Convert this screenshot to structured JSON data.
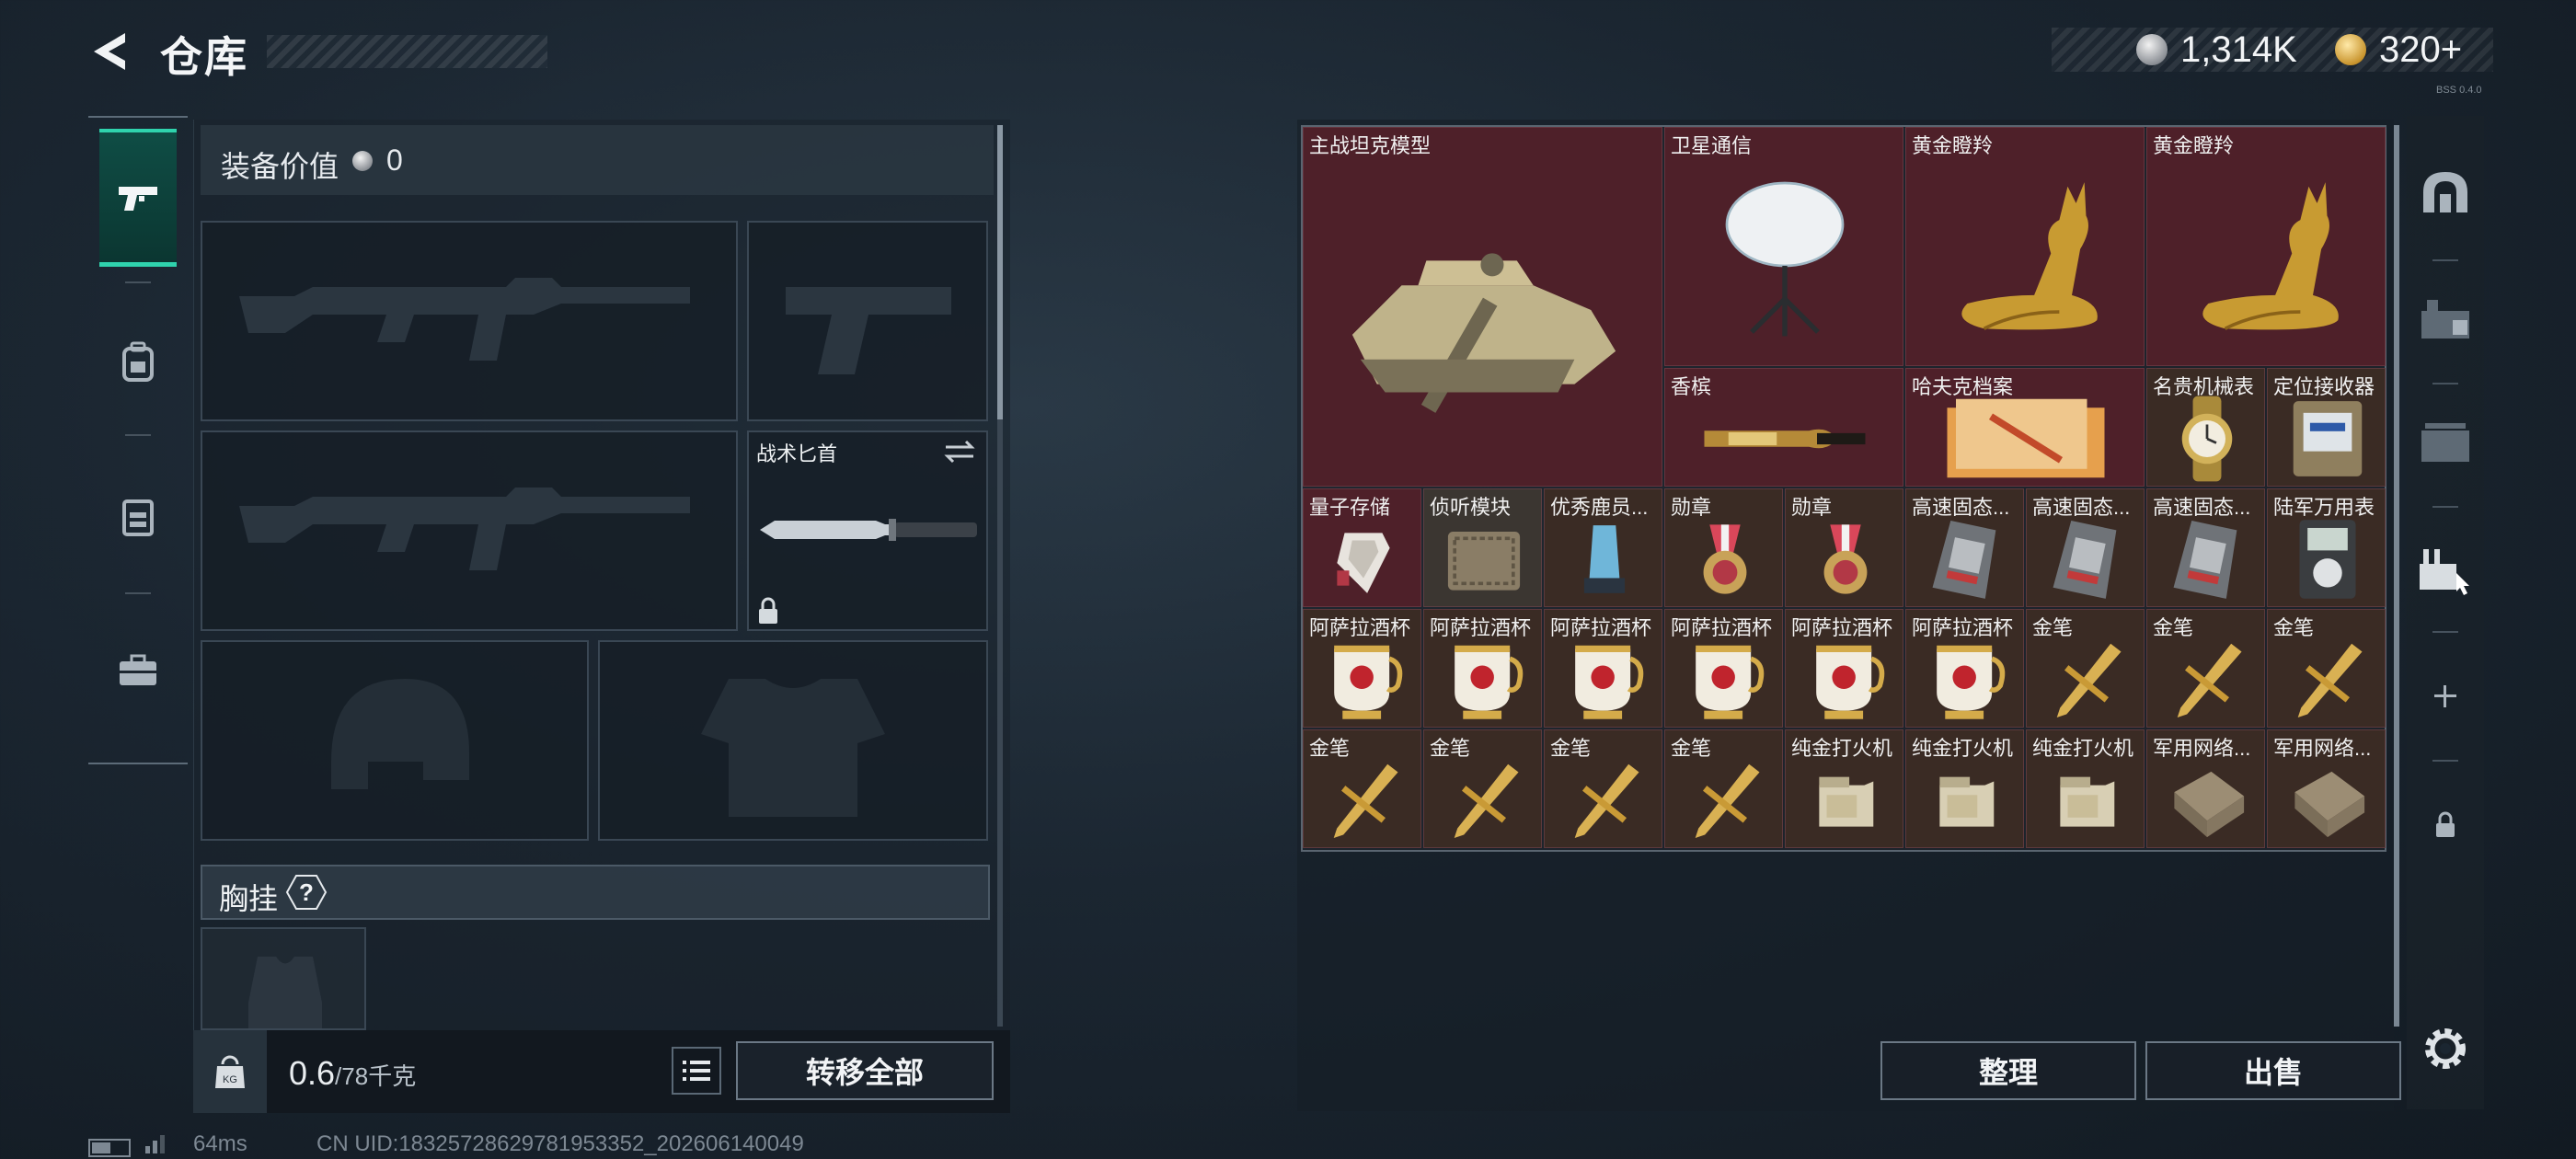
{
  "header": {
    "title": "仓库",
    "currency": [
      {
        "icon": "silver-coin-icon",
        "value": "1,314K"
      },
      {
        "icon": "gold-coin-icon",
        "value": "320+"
      }
    ],
    "version_tag": "BSS 0.4.0"
  },
  "left_tabs": [
    {
      "name": "weapon-tab",
      "icon": "pistol-icon",
      "active": true
    },
    {
      "name": "armor-tab",
      "icon": "backpack-icon",
      "active": false
    },
    {
      "name": "rig-tab",
      "icon": "chest-rig-icon",
      "active": false
    },
    {
      "name": "case-tab",
      "icon": "briefcase-icon",
      "active": false
    }
  ],
  "loadout": {
    "equip_value_label": "装备价值",
    "equip_value": "0",
    "knife_label": "战术匕首",
    "vest_label": "胸挂",
    "help_glyph": "?",
    "weight_current": "0.6",
    "weight_max": "/78千克",
    "transfer_all": "转移全部"
  },
  "stash": {
    "items": [
      {
        "label": "主战坦克模型",
        "bg": "red",
        "art": "tank-model-icon"
      },
      {
        "label": "卫星通信",
        "bg": "red",
        "art": "satellite-dish-icon"
      },
      {
        "label": "黄金瞪羚",
        "bg": "red",
        "art": "gold-gazelle-icon"
      },
      {
        "label": "黄金瞪羚",
        "bg": "red",
        "art": "gold-gazelle-icon"
      },
      {
        "label": "香槟",
        "bg": "red",
        "art": "champagne-icon"
      },
      {
        "label": "哈夫克档案",
        "bg": "red",
        "art": "folder-icon"
      },
      {
        "label": "名贵机械表",
        "bg": "brown",
        "art": "watch-icon"
      },
      {
        "label": "定位接收器",
        "bg": "brown",
        "art": "receiver-icon"
      },
      {
        "label": "量子存储",
        "bg": "red",
        "art": "quantum-storage-icon"
      },
      {
        "label": "侦听模块",
        "bg": "gray",
        "art": "module-icon"
      },
      {
        "label": "优秀鹿员...",
        "bg": "brown",
        "art": "trophy-icon"
      },
      {
        "label": "勋章",
        "bg": "brown",
        "art": "medal-icon"
      },
      {
        "label": "勋章",
        "bg": "brown",
        "art": "medal-icon"
      },
      {
        "label": "高速固态...",
        "bg": "brown",
        "art": "ssd-icon"
      },
      {
        "label": "高速固态...",
        "bg": "brown",
        "art": "ssd-icon"
      },
      {
        "label": "高速固态...",
        "bg": "brown",
        "art": "ssd-icon"
      },
      {
        "label": "陆军万用表",
        "bg": "brown",
        "art": "multimeter-icon"
      },
      {
        "label": "阿萨拉酒杯",
        "bg": "brown",
        "art": "goblet-icon"
      },
      {
        "label": "阿萨拉酒杯",
        "bg": "brown",
        "art": "goblet-icon"
      },
      {
        "label": "阿萨拉酒杯",
        "bg": "brown",
        "art": "goblet-icon"
      },
      {
        "label": "阿萨拉酒杯",
        "bg": "brown",
        "art": "goblet-icon"
      },
      {
        "label": "阿萨拉酒杯",
        "bg": "brown",
        "art": "goblet-icon"
      },
      {
        "label": "阿萨拉酒杯",
        "bg": "brown",
        "art": "goblet-icon"
      },
      {
        "label": "金笔",
        "bg": "brown",
        "art": "gold-pen-icon"
      },
      {
        "label": "金笔",
        "bg": "brown",
        "art": "gold-pen-icon"
      },
      {
        "label": "金笔",
        "bg": "brown",
        "art": "gold-pen-icon"
      },
      {
        "label": "金笔",
        "bg": "brown",
        "art": "gold-pen-icon"
      },
      {
        "label": "金笔",
        "bg": "brown",
        "art": "gold-pen-icon"
      },
      {
        "label": "金笔",
        "bg": "brown",
        "art": "gold-pen-icon"
      },
      {
        "label": "金笔",
        "bg": "brown",
        "art": "gold-pen-icon"
      },
      {
        "label": "纯金打火机",
        "bg": "brown",
        "art": "lighter-icon"
      },
      {
        "label": "纯金打火机",
        "bg": "brown",
        "art": "lighter-icon"
      },
      {
        "label": "纯金打火机",
        "bg": "brown",
        "art": "lighter-icon"
      },
      {
        "label": "军用网络...",
        "bg": "brown",
        "art": "network-module-icon"
      },
      {
        "label": "军用网络...",
        "bg": "brown",
        "art": "network-module-icon"
      }
    ],
    "sort_label": "整理",
    "sell_label": "出售"
  },
  "right_tabs": [
    {
      "name": "rtab-safe",
      "icon": "safe-icon"
    },
    {
      "name": "rtab-item-1",
      "icon": "storage-icon"
    },
    {
      "name": "rtab-item-2",
      "icon": "storage-icon"
    },
    {
      "name": "rtab-item-3",
      "icon": "storage-active-icon"
    },
    {
      "name": "rtab-add",
      "icon": "plus-icon"
    },
    {
      "name": "rtab-lock",
      "icon": "lock-icon"
    }
  ],
  "status": {
    "ping": "64ms",
    "uid": "CN UID:18325728629781953352_202606140049"
  },
  "colors": {
    "accent_teal": "#2fd3ad",
    "cell_red": "#4e2029",
    "cell_brown": "#3a2b24",
    "cell_gray": "#3b3631"
  }
}
